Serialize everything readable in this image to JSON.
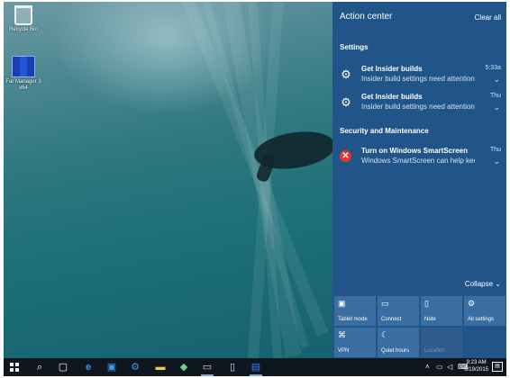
{
  "desktop": {
    "icons": [
      {
        "label": "Recycle Bin",
        "icon": "recycle-bin-icon"
      },
      {
        "label": "Far Manager 3 x64",
        "icon": "far-manager-icon"
      }
    ]
  },
  "action_center": {
    "title": "Action center",
    "clear_all": "Clear all",
    "sections": [
      {
        "heading": "Settings",
        "notifications": [
          {
            "title": "Get Insider builds",
            "body": "Insider build settings need attention",
            "time": "5:33a",
            "icon": "gear-icon"
          },
          {
            "title": "Get Insider builds",
            "body": "Insider build settings need attention",
            "time": "Thu",
            "icon": "gear-icon"
          }
        ]
      },
      {
        "heading": "Security and Maintenance",
        "notifications": [
          {
            "title": "Turn on Windows SmartScreen",
            "body": "Windows SmartScreen can help keep",
            "time": "Thu",
            "icon": "error-icon"
          }
        ]
      }
    ],
    "collapse": "Collapse",
    "quick_actions": [
      {
        "label": "Tablet mode",
        "icon": "tablet-mode-icon",
        "enabled": true
      },
      {
        "label": "Connect",
        "icon": "connect-icon",
        "enabled": true
      },
      {
        "label": "Note",
        "icon": "note-icon",
        "enabled": true
      },
      {
        "label": "All settings",
        "icon": "gear-icon",
        "enabled": true
      },
      {
        "label": "VPN",
        "icon": "vpn-icon",
        "enabled": true
      },
      {
        "label": "Quiet hours",
        "icon": "moon-icon",
        "enabled": true
      },
      {
        "label": "Location",
        "icon": "location-icon",
        "enabled": false
      }
    ]
  },
  "taskbar": {
    "items": [
      "start-icon",
      "search-icon",
      "task-view-icon",
      "edge-icon",
      "store-icon",
      "settings-icon",
      "file-explorer-icon",
      "app-icon",
      "command-prompt-icon",
      "notepad-icon",
      "far-manager-icon"
    ],
    "tray_icons": [
      "chevron-up-icon",
      "network-icon",
      "volume-icon",
      "keyboard-icon"
    ],
    "time": "9:23 AM",
    "date": "6/19/2015"
  },
  "colors": {
    "action_center_bg": "#21558a",
    "quick_action_tile": "#3a6ea2",
    "taskbar_bg": "#0f1620",
    "error_red": "#e8322b"
  }
}
